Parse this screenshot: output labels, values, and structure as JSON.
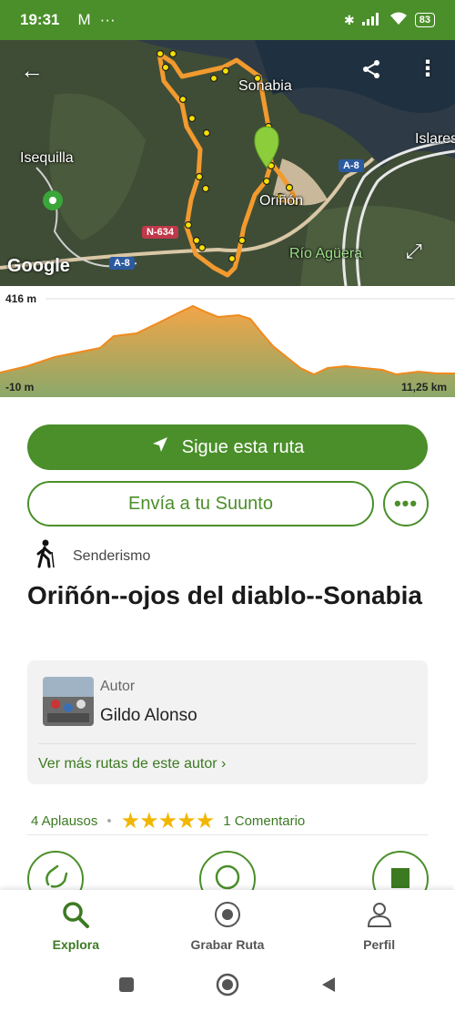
{
  "status_bar": {
    "time": "19:31",
    "battery": "83"
  },
  "map": {
    "labels": {
      "sonabia": "Sonabia",
      "islares": "Islares",
      "isequilla": "Isequilla",
      "orinon": "Oriñón",
      "rio_aguera": "Río Agüera"
    },
    "roads": {
      "a8_top": "A-8",
      "a8_bottom": "A-8",
      "n634": "N-634"
    },
    "provider": "Google"
  },
  "elevation": {
    "max_label": "416 m",
    "min_label": "-10 m",
    "distance_label": "11,25 km"
  },
  "actions": {
    "follow_label": "Sigue esta ruta",
    "suunto_label": "Envía a tu Suunto",
    "more_label": "•••"
  },
  "route": {
    "activity": "Senderismo",
    "title": "Oriñón--ojos del diablo--Sonabia"
  },
  "author": {
    "role": "Autor",
    "name": "Gildo Alonso",
    "more_routes": "Ver más rutas de este autor ›"
  },
  "stats": {
    "claps": "4 Aplausos",
    "separator": "•",
    "stars": "★★★★★",
    "comments": "1 Comentario"
  },
  "nav": {
    "explore": "Explora",
    "record": "Grabar Ruta",
    "profile": "Perfil"
  },
  "colors": {
    "primary": "#4a8f2a",
    "route_line": "#f29a2e",
    "star": "#f2b600"
  }
}
